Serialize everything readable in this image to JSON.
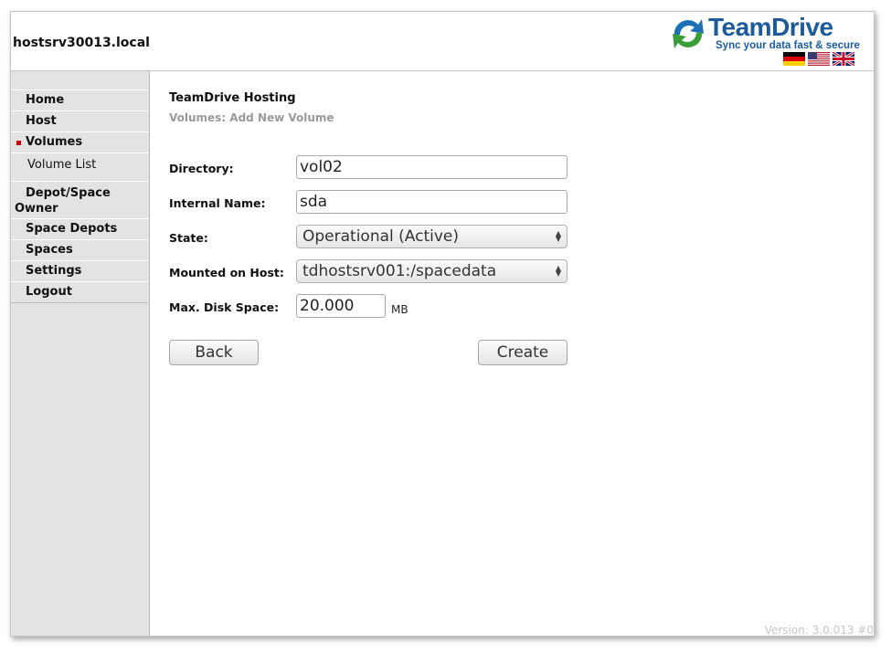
{
  "header": {
    "hostname": "hostsrv30013.local",
    "logo_title": "TeamDrive",
    "logo_tagline": "Sync your data fast & secure",
    "flags": [
      "flag-germany-icon",
      "flag-usa-icon",
      "flag-uk-icon"
    ]
  },
  "sidebar": {
    "home": "Home",
    "host": "Host",
    "volumes": "Volumes",
    "volume_list": "Volume List",
    "depot_line1": "Depot/Space",
    "depot_line2": "Owner",
    "space_depots": "Space Depots",
    "spaces": "Spaces",
    "settings": "Settings",
    "logout": "Logout",
    "active_marker_color": "#cc0000"
  },
  "main": {
    "title": "TeamDrive Hosting",
    "subtitle": "Volumes: Add New Volume",
    "form": {
      "directory_label": "Directory:",
      "directory_value": "vol02",
      "internal_name_label": "Internal Name:",
      "internal_name_value": "sda",
      "state_label": "State:",
      "state_value": "Operational (Active)",
      "mounted_label": "Mounted on Host:",
      "mounted_value": "tdhostsrv001:/spacedata",
      "max_disk_label": "Max. Disk Space:",
      "max_disk_value": "20.000",
      "max_disk_unit": "MB"
    },
    "buttons": {
      "back": "Back",
      "create": "Create"
    }
  },
  "footer": {
    "version": "Version: 3.0.013 #0"
  }
}
